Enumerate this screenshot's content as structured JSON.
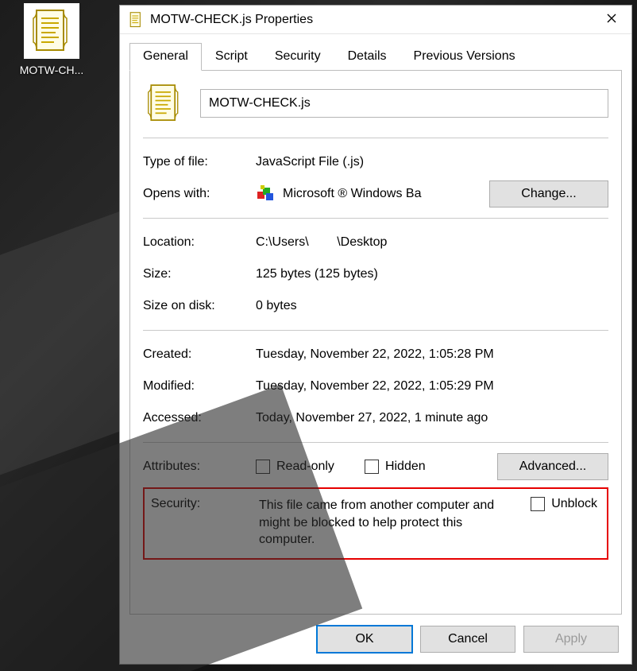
{
  "desktop_icon": {
    "label": "MOTW-CH...",
    "icon": "js-script-icon"
  },
  "window": {
    "title": "MOTW-CHECK.js Properties",
    "title_icon": "js-script-icon"
  },
  "tabs": {
    "items": [
      "General",
      "Script",
      "Security",
      "Details",
      "Previous Versions"
    ],
    "active_index": 0
  },
  "file": {
    "name": "MOTW-CHECK.js",
    "icon": "js-script-icon"
  },
  "type": {
    "label": "Type of file:",
    "value": "JavaScript File (.js)"
  },
  "opens": {
    "label": "Opens with:",
    "app_icon": "wsh-color-blocks-icon",
    "app_name": "Microsoft ® Windows Ba",
    "change_button": "Change..."
  },
  "location": {
    "label": "Location:",
    "value": "C:\\Users\\        \\Desktop"
  },
  "size": {
    "label": "Size:",
    "value": "125 bytes (125 bytes)"
  },
  "size_on_disk": {
    "label": "Size on disk:",
    "value": "0 bytes"
  },
  "created": {
    "label": "Created:",
    "value": "Tuesday, November 22, 2022, 1:05:28 PM"
  },
  "modified": {
    "label": "Modified:",
    "value": "Tuesday, November 22, 2022, 1:05:29 PM"
  },
  "accessed": {
    "label": "Accessed:",
    "value": "Today, November 27, 2022, 1 minute ago"
  },
  "attributes": {
    "label": "Attributes:",
    "readonly_label": "Read-only",
    "readonly_checked": false,
    "hidden_label": "Hidden",
    "hidden_checked": false,
    "advanced_button": "Advanced..."
  },
  "security": {
    "label": "Security:",
    "message": "This file came from another computer and might be blocked to help protect this computer.",
    "unblock_label": "Unblock",
    "unblock_checked": false
  },
  "footer": {
    "ok": "OK",
    "cancel": "Cancel",
    "apply": "Apply"
  }
}
